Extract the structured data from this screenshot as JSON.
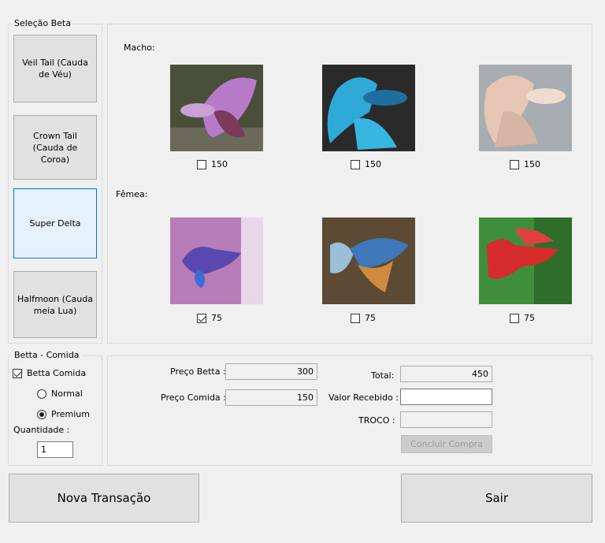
{
  "selecao": {
    "title": "Seleção Beta",
    "breeds": [
      {
        "label": "Veil Tail (Cauda de Véu)",
        "active": false
      },
      {
        "label": "Crown Tail (Cauda de Coroa)",
        "active": false
      },
      {
        "label": "Super Delta",
        "active": true
      },
      {
        "label": "Halfmoon (Cauda meia Lua)",
        "active": false
      }
    ]
  },
  "fish": {
    "macho_label": "Macho:",
    "femea_label": "Fêmea:",
    "macho": [
      {
        "price": "150",
        "checked": false,
        "icon": "betta-purple-photo"
      },
      {
        "price": "150",
        "checked": false,
        "icon": "betta-blue-photo"
      },
      {
        "price": "150",
        "checked": false,
        "icon": "betta-white-photo"
      }
    ],
    "femea": [
      {
        "price": "75",
        "checked": true,
        "icon": "betta-purple-female-photo"
      },
      {
        "price": "75",
        "checked": false,
        "icon": "betta-multicolor-photo"
      },
      {
        "price": "75",
        "checked": false,
        "icon": "betta-red-photo"
      }
    ]
  },
  "comida": {
    "title": "Betta - Comida",
    "checkbox_label": "Betta Comida",
    "checked": true,
    "normal_label": "Normal",
    "premium_label": "Premium",
    "selected": "premium",
    "quantidade_label": "Quantidade :",
    "quantidade_value": "1"
  },
  "summary": {
    "preco_betta_label": "Preço Betta :",
    "preco_betta_value": "300",
    "preco_comida_label": "Preço Comida :",
    "preco_comida_value": "150",
    "total_label": "Total:",
    "total_value": "450",
    "valor_recebido_label": "Valor Recebido :",
    "valor_recebido_value": "",
    "troco_label": "TROCO :",
    "troco_value": "",
    "concluir_label": "Concluir Compra"
  },
  "actions": {
    "nova_label": "Nova Transação",
    "sair_label": "Sair"
  }
}
